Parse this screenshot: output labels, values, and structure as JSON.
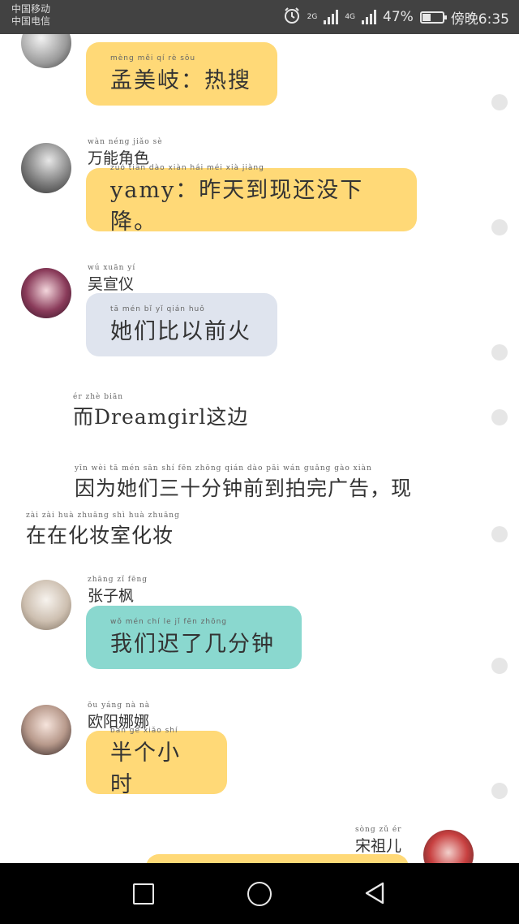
{
  "status_bar": {
    "carrier_1": "中国移动",
    "carrier_2": "中国电信",
    "net_1": "2G",
    "net_2": "4G",
    "battery": "47%",
    "battery_level": 0.47,
    "time": "傍晚6:35"
  },
  "messages": [
    {
      "sender_pinyin": "",
      "sender": "",
      "bubble_pinyin": "mèng  měi  qí      rè  sōu",
      "text": "孟美岐：热搜",
      "color": "#ffd977"
    },
    {
      "sender_pinyin": "wàn néng jiǎo sè",
      "sender": "万能角色",
      "bubble_pinyin": "zuó  tiān  dào  xiàn  hái  méi  xià  jiàng",
      "text": "yamy：昨天到现还没下降。",
      "color": "#ffd977"
    },
    {
      "sender_pinyin": "wú xuān yí",
      "sender": "吴宣仪",
      "bubble_pinyin": "tā  mén  bǐ  yǐ  qián  huǒ",
      "text": "她们比以前火",
      "color": "#dfe4ee"
    },
    {
      "sender_pinyin": "zhāng zǐ fēng",
      "sender": "张子枫",
      "bubble_pinyin": "wǒ  mén  chí  le  jǐ  fēn zhōng",
      "text": "我们迟了几分钟",
      "color": "#8ad8cf"
    },
    {
      "sender_pinyin": "ōu yáng nà nà",
      "sender": "欧阳娜娜",
      "bubble_pinyin": "bàn  gè  xiǎo  shí",
      "text": "半个小时",
      "color": "#ffd977"
    },
    {
      "sender_pinyin": "sòng zǔ ér",
      "sender": "宋祖儿",
      "bubble_pinyin": "",
      "text": "",
      "color": "#ffd977"
    }
  ],
  "narration": {
    "line1_pinyin": "ér                          zhè  biān",
    "line1": "而Dreamgirl这边",
    "line2_pinyin": "yīn  wèi  tā  mén  sān  shí  fēn zhōng qián  dào  pāi  wán guǎng gào      xiàn",
    "line2": "因为她们三十分钟前到拍完广告，现",
    "line3_pinyin": "zài  zài  huà zhuāng shì  huà zhuāng",
    "line3": "在在化妆室化妆"
  }
}
